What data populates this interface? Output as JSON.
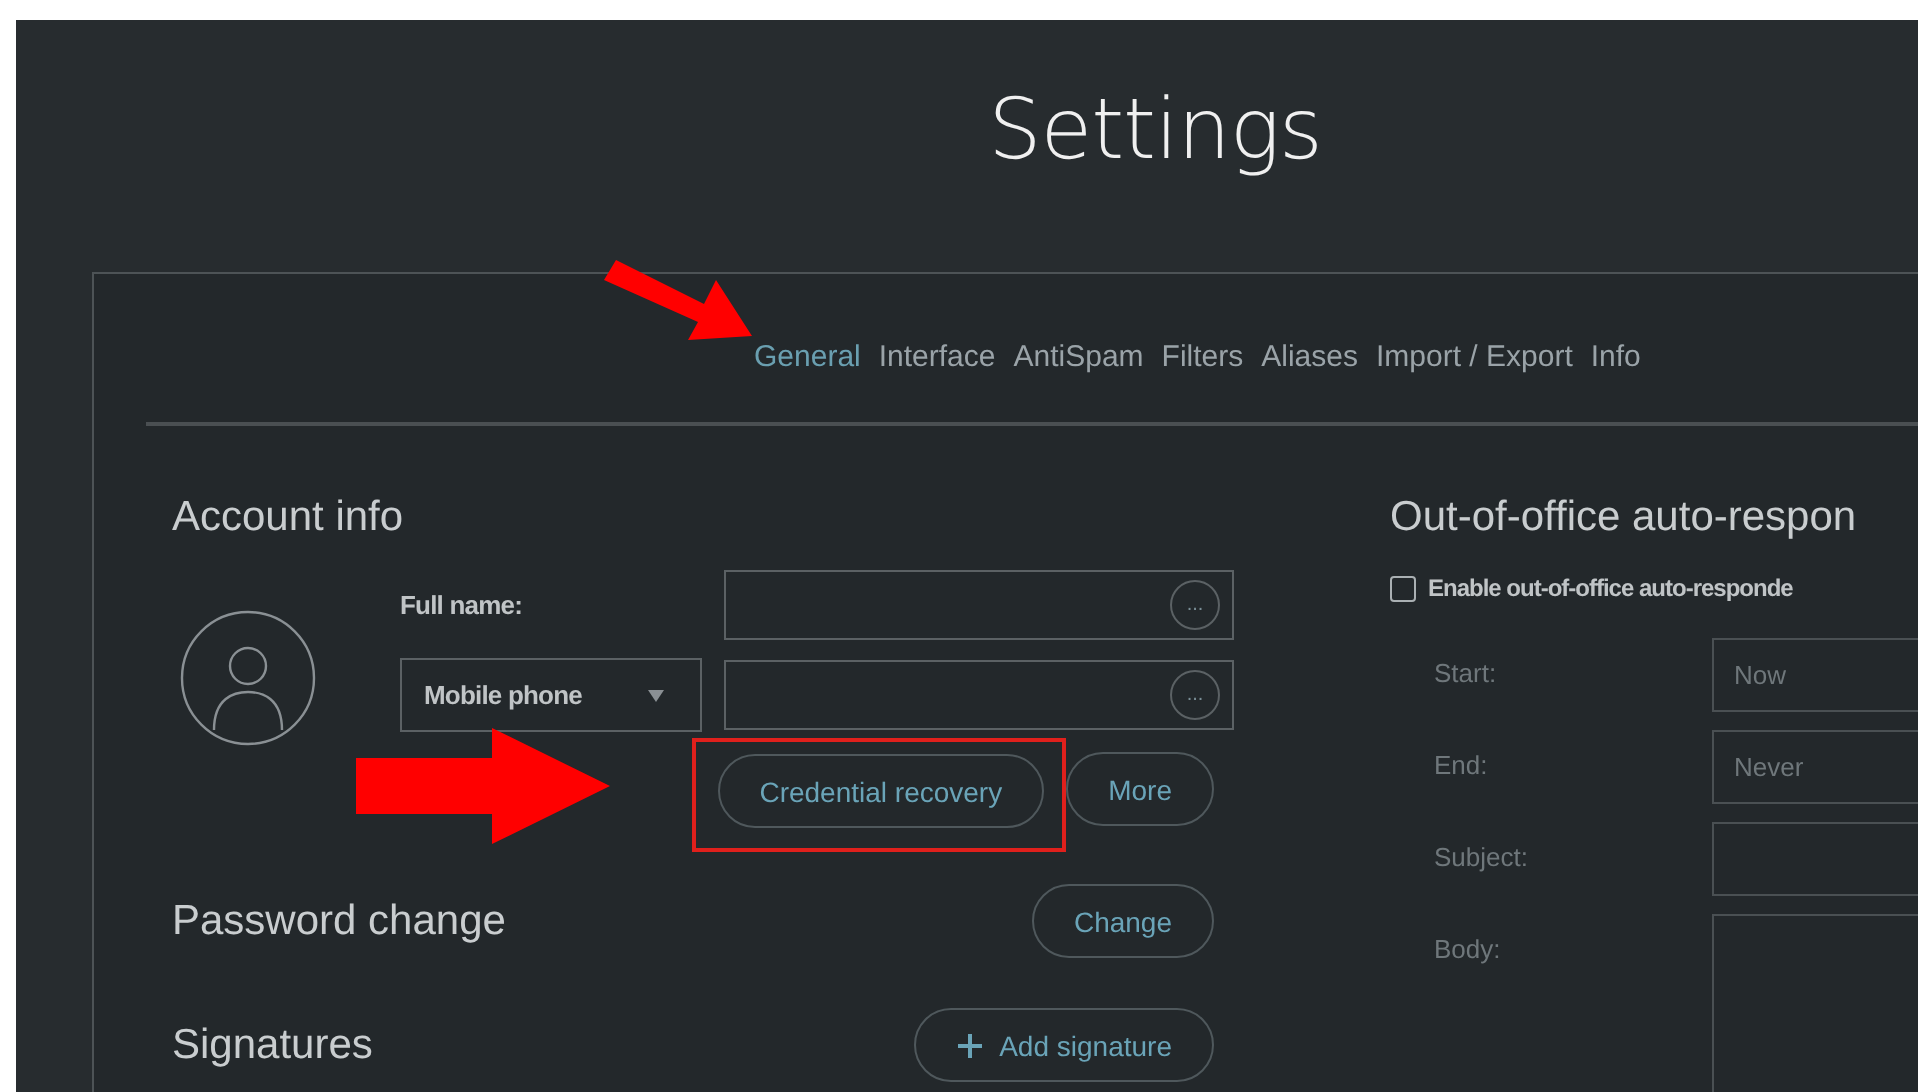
{
  "title": "Settings",
  "tabs": [
    {
      "label": "General",
      "selected": true
    },
    {
      "label": "Interface",
      "selected": false
    },
    {
      "label": "AntiSpam",
      "selected": false
    },
    {
      "label": "Filters",
      "selected": false
    },
    {
      "label": "Aliases",
      "selected": false
    },
    {
      "label": "Import / Export",
      "selected": false
    },
    {
      "label": "Info",
      "selected": false
    }
  ],
  "account": {
    "heading": "Account info",
    "full_name": {
      "label": "Full name:",
      "more": "..."
    },
    "phone": {
      "select": "Mobile phone",
      "more": "..."
    },
    "buttons": [
      {
        "label": "Credential recovery",
        "highlighted": true
      },
      {
        "label": "More",
        "highlighted": false
      }
    ]
  },
  "password": {
    "heading": "Password change",
    "button": "Change"
  },
  "signatures": {
    "heading": "Signatures",
    "button": "Add signature"
  },
  "auto_responder": {
    "heading": "Out-of-office auto-respon",
    "enable": {
      "label": "Enable out-of-office auto-responde",
      "checked": false
    },
    "fields": [
      {
        "kind": "input",
        "label": "Start:",
        "value": "Now"
      },
      {
        "kind": "input",
        "label": "End:",
        "value": "Never"
      },
      {
        "kind": "input",
        "label": "Subject:"
      },
      {
        "kind": "textarea",
        "label": "Body:"
      }
    ]
  }
}
